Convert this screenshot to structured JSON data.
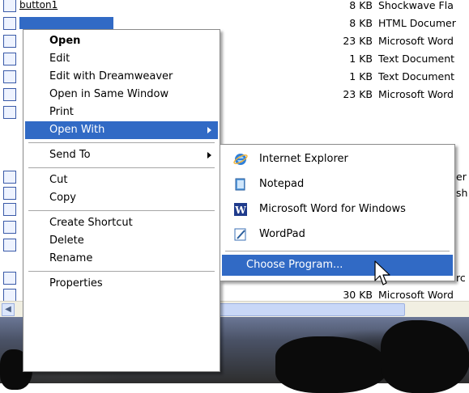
{
  "file_list": {
    "rows": [
      {
        "name": "button1",
        "size": "8 KB",
        "type": "Shockwave Fla"
      },
      {
        "name": "",
        "size": "8 KB",
        "type": "HTML Documer"
      },
      {
        "name": "",
        "size": "23 KB",
        "type": "Microsoft Word"
      },
      {
        "name": "",
        "size": "1 KB",
        "type": "Text Document"
      },
      {
        "name": "",
        "size": "1 KB",
        "type": "Text Document"
      },
      {
        "name": "",
        "size": "23 KB",
        "type": "Microsoft Word"
      },
      {
        "name": "",
        "size": "",
        "type": ""
      },
      {
        "name": "",
        "size": "",
        "type": "er"
      },
      {
        "name": "",
        "size": "",
        "type": "sh"
      },
      {
        "name": "",
        "size": "",
        "type": ""
      },
      {
        "name": "",
        "size": "",
        "type": ""
      },
      {
        "name": "",
        "size": "",
        "type": ""
      },
      {
        "name": "",
        "size": "",
        "type": "rc"
      },
      {
        "name": "",
        "size": "30 KB",
        "type": "Microsoft Word"
      }
    ]
  },
  "context_menu": {
    "open": "Open",
    "edit": "Edit",
    "edit_dreamweaver": "Edit with Dreamweaver",
    "open_same_window": "Open in Same Window",
    "print": "Print",
    "open_with": "Open With",
    "send_to": "Send To",
    "cut": "Cut",
    "copy": "Copy",
    "create_shortcut": "Create Shortcut",
    "delete": "Delete",
    "rename": "Rename",
    "properties": "Properties"
  },
  "open_with_submenu": {
    "internet_explorer": "Internet Explorer",
    "notepad": "Notepad",
    "word": "Microsoft Word for Windows",
    "wordpad": "WordPad",
    "choose_program": "Choose Program..."
  },
  "colors": {
    "highlight": "#316ac5",
    "menu_bg": "#ffffff"
  },
  "icons": [
    "internet-explorer-icon",
    "notepad-icon",
    "word-icon",
    "wordpad-icon",
    "mouse-cursor-icon",
    "scroll-left-icon"
  ]
}
